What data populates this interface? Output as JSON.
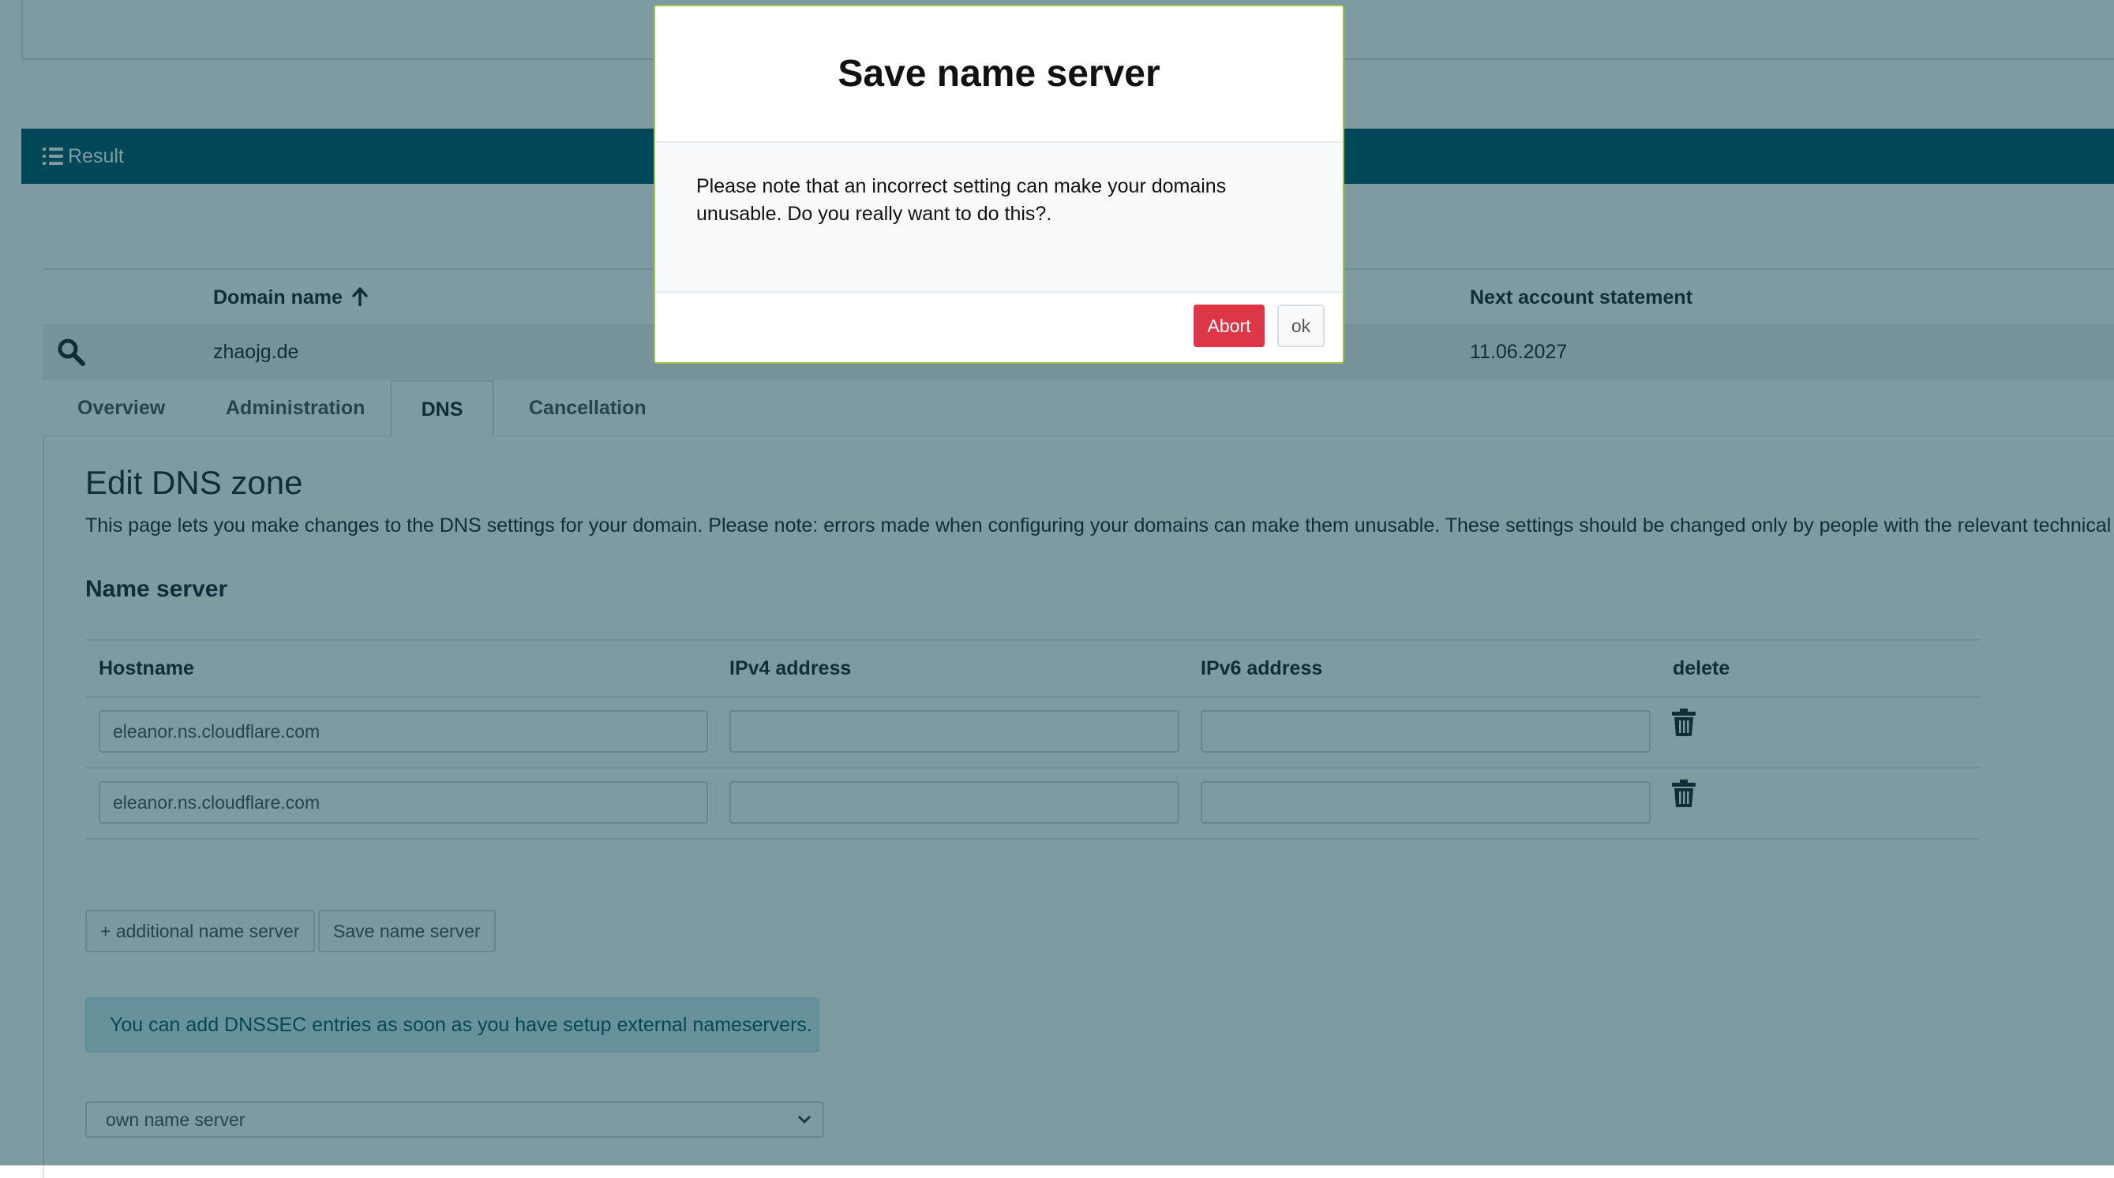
{
  "result": {
    "title": "Result"
  },
  "domain_table": {
    "headers": {
      "domain_name": "Domain name",
      "next_statement": "Next account statement"
    },
    "row": {
      "domain": "zhaojg.de",
      "next_statement": "11.06.2027"
    }
  },
  "tabs": [
    {
      "label": "Overview",
      "active": false
    },
    {
      "label": "Administration",
      "active": false
    },
    {
      "label": "DNS",
      "active": true
    },
    {
      "label": "Cancellation",
      "active": false
    }
  ],
  "dns": {
    "heading": "Edit DNS zone",
    "description": "This page lets you make changes to the DNS settings for your domain. Please note: errors made when configuring your domains can make them unusable. These settings should be changed only by people with the relevant technical know",
    "name_server_heading": "Name server",
    "columns": [
      "Hostname",
      "IPv4 address",
      "IPv6 address",
      "delete"
    ],
    "rows": [
      {
        "hostname": "eleanor.ns.cloudflare.com",
        "ipv4": "",
        "ipv6": ""
      },
      {
        "hostname": "eleanor.ns.cloudflare.com",
        "ipv4": "",
        "ipv6": ""
      }
    ],
    "add_button": "+ additional name server",
    "save_button": "Save name server",
    "dnssec_info": "You can add DNSSEC entries as soon as you have setup external nameservers.",
    "select_value": "own name server"
  },
  "modal": {
    "title": "Save name server",
    "body": "Please note that an incorrect setting can make your domains unusable. Do you really want to do this?.",
    "abort": "Abort",
    "ok": "ok"
  },
  "colors": {
    "header_bar": "#00566b",
    "danger": "#dc3545",
    "modal_border": "#9bc34a",
    "alert_bg": "#d1ecf1"
  }
}
